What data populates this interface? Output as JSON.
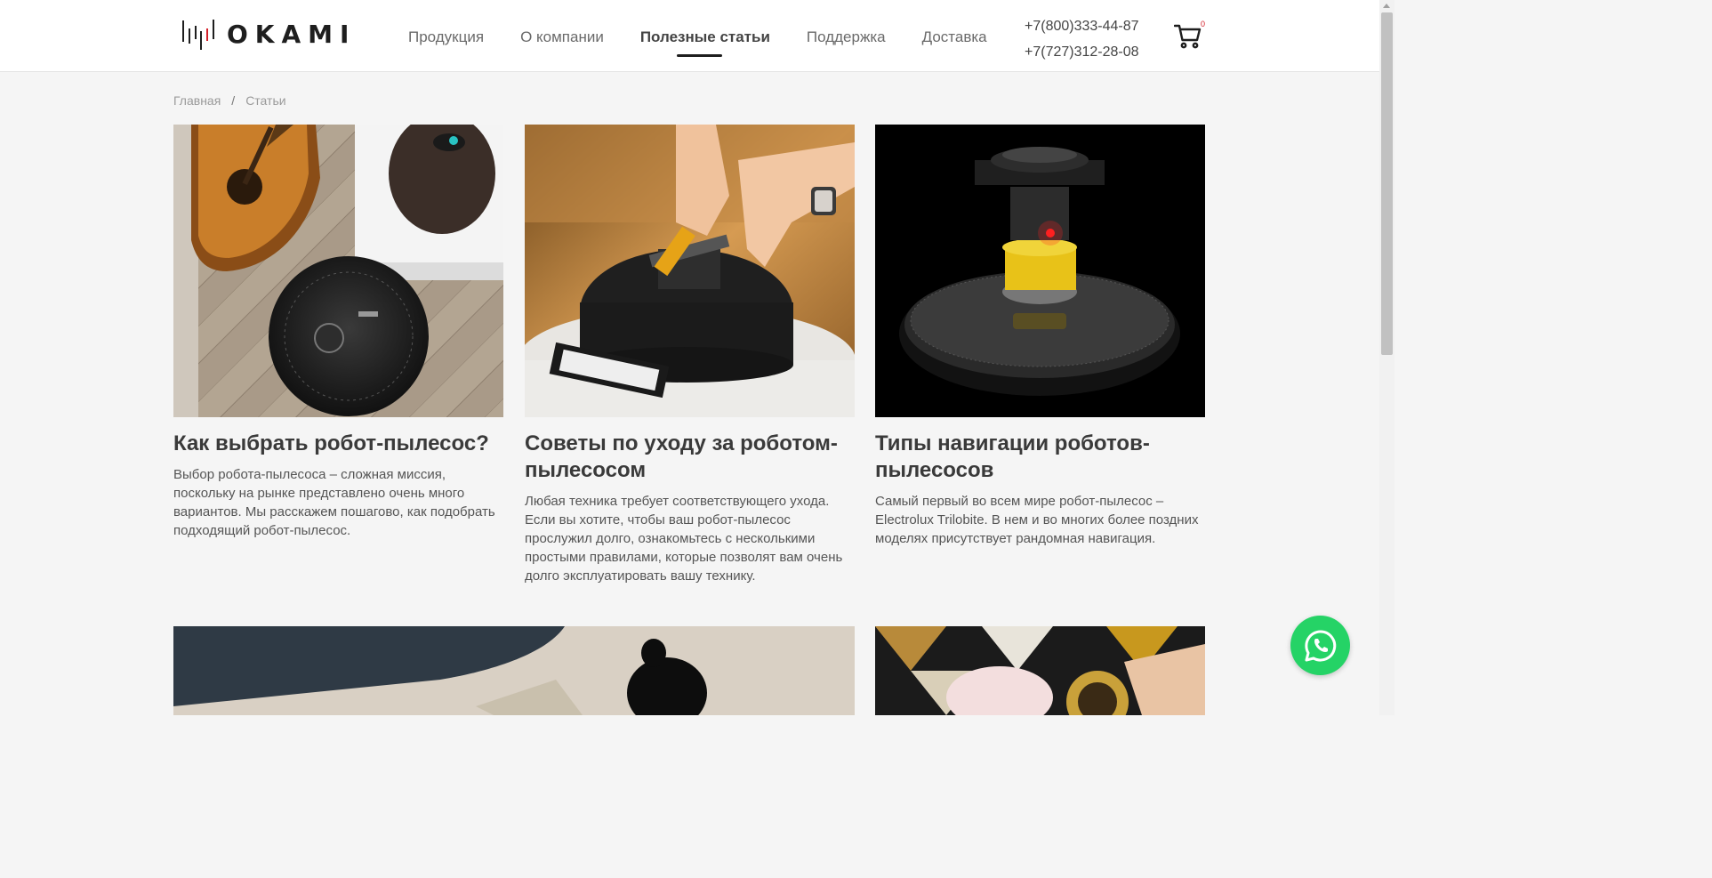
{
  "logo": {
    "text": "OKAMI"
  },
  "nav": {
    "items": [
      {
        "label": "Продукция"
      },
      {
        "label": "О компании"
      },
      {
        "label": "Полезные статьи",
        "active": true
      },
      {
        "label": "Поддержка"
      },
      {
        "label": "Доставка"
      }
    ]
  },
  "contacts": {
    "phone1": "+7(800)333-44-87",
    "phone2": "+7(727)312-28-08"
  },
  "cart": {
    "count": "0",
    "icon": "cart-icon"
  },
  "breadcrumb": {
    "home": "Главная",
    "separator": "/",
    "current": "Статьи"
  },
  "articles": [
    {
      "title": "Как выбрать робот-пылесос?",
      "excerpt": "Выбор робота-пылесоса – сложная миссия, поскольку на рынке представлено очень много вариантов. Мы расскажем пошагово, как подобрать подходящий робот-пылесос."
    },
    {
      "title": "Советы по уходу за роботом-пылесосом",
      "excerpt": "Любая техника требует соответствующего ухода. Если вы хотите, чтобы ваш робот-пылесос прослужил долго, ознакомьтесь с несколькими простыми правилами, которые позволят вам очень долго эксплуатировать вашу технику."
    },
    {
      "title": "Типы навигации роботов-пылесосов",
      "excerpt": "Самый первый во всем мире робот-пылесос – Electrolux Trilobite. В нем и во многих более поздних моделях присутствует рандомная навигация."
    }
  ],
  "colors": {
    "accent": "#1e1e1e",
    "whatsapp": "#25d366",
    "cart_badge": "#d4202a",
    "background": "#f5f5f5"
  }
}
